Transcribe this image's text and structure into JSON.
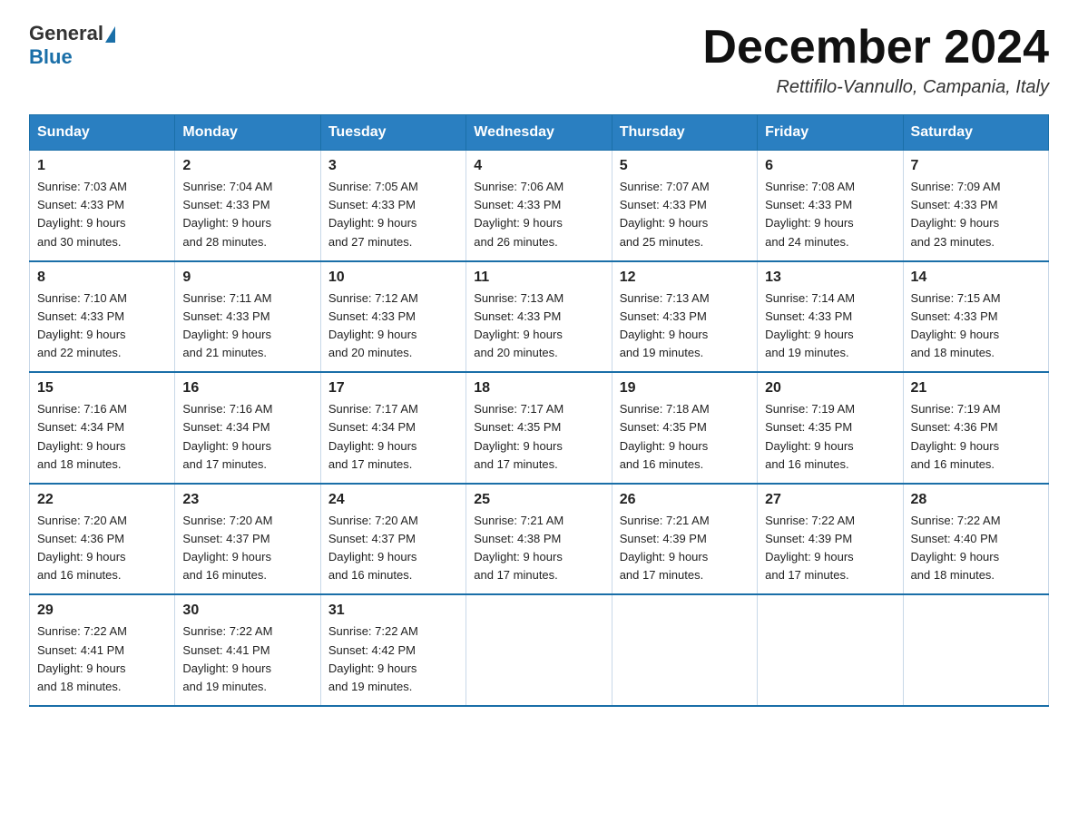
{
  "logo": {
    "text_general": "General",
    "text_blue": "Blue"
  },
  "title": {
    "month_year": "December 2024",
    "location": "Rettifilo-Vannullo, Campania, Italy"
  },
  "weekdays": [
    "Sunday",
    "Monday",
    "Tuesday",
    "Wednesday",
    "Thursday",
    "Friday",
    "Saturday"
  ],
  "weeks": [
    [
      {
        "day": "1",
        "sunrise": "7:03 AM",
        "sunset": "4:33 PM",
        "daylight": "9 hours and 30 minutes."
      },
      {
        "day": "2",
        "sunrise": "7:04 AM",
        "sunset": "4:33 PM",
        "daylight": "9 hours and 28 minutes."
      },
      {
        "day": "3",
        "sunrise": "7:05 AM",
        "sunset": "4:33 PM",
        "daylight": "9 hours and 27 minutes."
      },
      {
        "day": "4",
        "sunrise": "7:06 AM",
        "sunset": "4:33 PM",
        "daylight": "9 hours and 26 minutes."
      },
      {
        "day": "5",
        "sunrise": "7:07 AM",
        "sunset": "4:33 PM",
        "daylight": "9 hours and 25 minutes."
      },
      {
        "day": "6",
        "sunrise": "7:08 AM",
        "sunset": "4:33 PM",
        "daylight": "9 hours and 24 minutes."
      },
      {
        "day": "7",
        "sunrise": "7:09 AM",
        "sunset": "4:33 PM",
        "daylight": "9 hours and 23 minutes."
      }
    ],
    [
      {
        "day": "8",
        "sunrise": "7:10 AM",
        "sunset": "4:33 PM",
        "daylight": "9 hours and 22 minutes."
      },
      {
        "day": "9",
        "sunrise": "7:11 AM",
        "sunset": "4:33 PM",
        "daylight": "9 hours and 21 minutes."
      },
      {
        "day": "10",
        "sunrise": "7:12 AM",
        "sunset": "4:33 PM",
        "daylight": "9 hours and 20 minutes."
      },
      {
        "day": "11",
        "sunrise": "7:13 AM",
        "sunset": "4:33 PM",
        "daylight": "9 hours and 20 minutes."
      },
      {
        "day": "12",
        "sunrise": "7:13 AM",
        "sunset": "4:33 PM",
        "daylight": "9 hours and 19 minutes."
      },
      {
        "day": "13",
        "sunrise": "7:14 AM",
        "sunset": "4:33 PM",
        "daylight": "9 hours and 19 minutes."
      },
      {
        "day": "14",
        "sunrise": "7:15 AM",
        "sunset": "4:33 PM",
        "daylight": "9 hours and 18 minutes."
      }
    ],
    [
      {
        "day": "15",
        "sunrise": "7:16 AM",
        "sunset": "4:34 PM",
        "daylight": "9 hours and 18 minutes."
      },
      {
        "day": "16",
        "sunrise": "7:16 AM",
        "sunset": "4:34 PM",
        "daylight": "9 hours and 17 minutes."
      },
      {
        "day": "17",
        "sunrise": "7:17 AM",
        "sunset": "4:34 PM",
        "daylight": "9 hours and 17 minutes."
      },
      {
        "day": "18",
        "sunrise": "7:17 AM",
        "sunset": "4:35 PM",
        "daylight": "9 hours and 17 minutes."
      },
      {
        "day": "19",
        "sunrise": "7:18 AM",
        "sunset": "4:35 PM",
        "daylight": "9 hours and 16 minutes."
      },
      {
        "day": "20",
        "sunrise": "7:19 AM",
        "sunset": "4:35 PM",
        "daylight": "9 hours and 16 minutes."
      },
      {
        "day": "21",
        "sunrise": "7:19 AM",
        "sunset": "4:36 PM",
        "daylight": "9 hours and 16 minutes."
      }
    ],
    [
      {
        "day": "22",
        "sunrise": "7:20 AM",
        "sunset": "4:36 PM",
        "daylight": "9 hours and 16 minutes."
      },
      {
        "day": "23",
        "sunrise": "7:20 AM",
        "sunset": "4:37 PM",
        "daylight": "9 hours and 16 minutes."
      },
      {
        "day": "24",
        "sunrise": "7:20 AM",
        "sunset": "4:37 PM",
        "daylight": "9 hours and 16 minutes."
      },
      {
        "day": "25",
        "sunrise": "7:21 AM",
        "sunset": "4:38 PM",
        "daylight": "9 hours and 17 minutes."
      },
      {
        "day": "26",
        "sunrise": "7:21 AM",
        "sunset": "4:39 PM",
        "daylight": "9 hours and 17 minutes."
      },
      {
        "day": "27",
        "sunrise": "7:22 AM",
        "sunset": "4:39 PM",
        "daylight": "9 hours and 17 minutes."
      },
      {
        "day": "28",
        "sunrise": "7:22 AM",
        "sunset": "4:40 PM",
        "daylight": "9 hours and 18 minutes."
      }
    ],
    [
      {
        "day": "29",
        "sunrise": "7:22 AM",
        "sunset": "4:41 PM",
        "daylight": "9 hours and 18 minutes."
      },
      {
        "day": "30",
        "sunrise": "7:22 AM",
        "sunset": "4:41 PM",
        "daylight": "9 hours and 19 minutes."
      },
      {
        "day": "31",
        "sunrise": "7:22 AM",
        "sunset": "4:42 PM",
        "daylight": "9 hours and 19 minutes."
      },
      null,
      null,
      null,
      null
    ]
  ]
}
